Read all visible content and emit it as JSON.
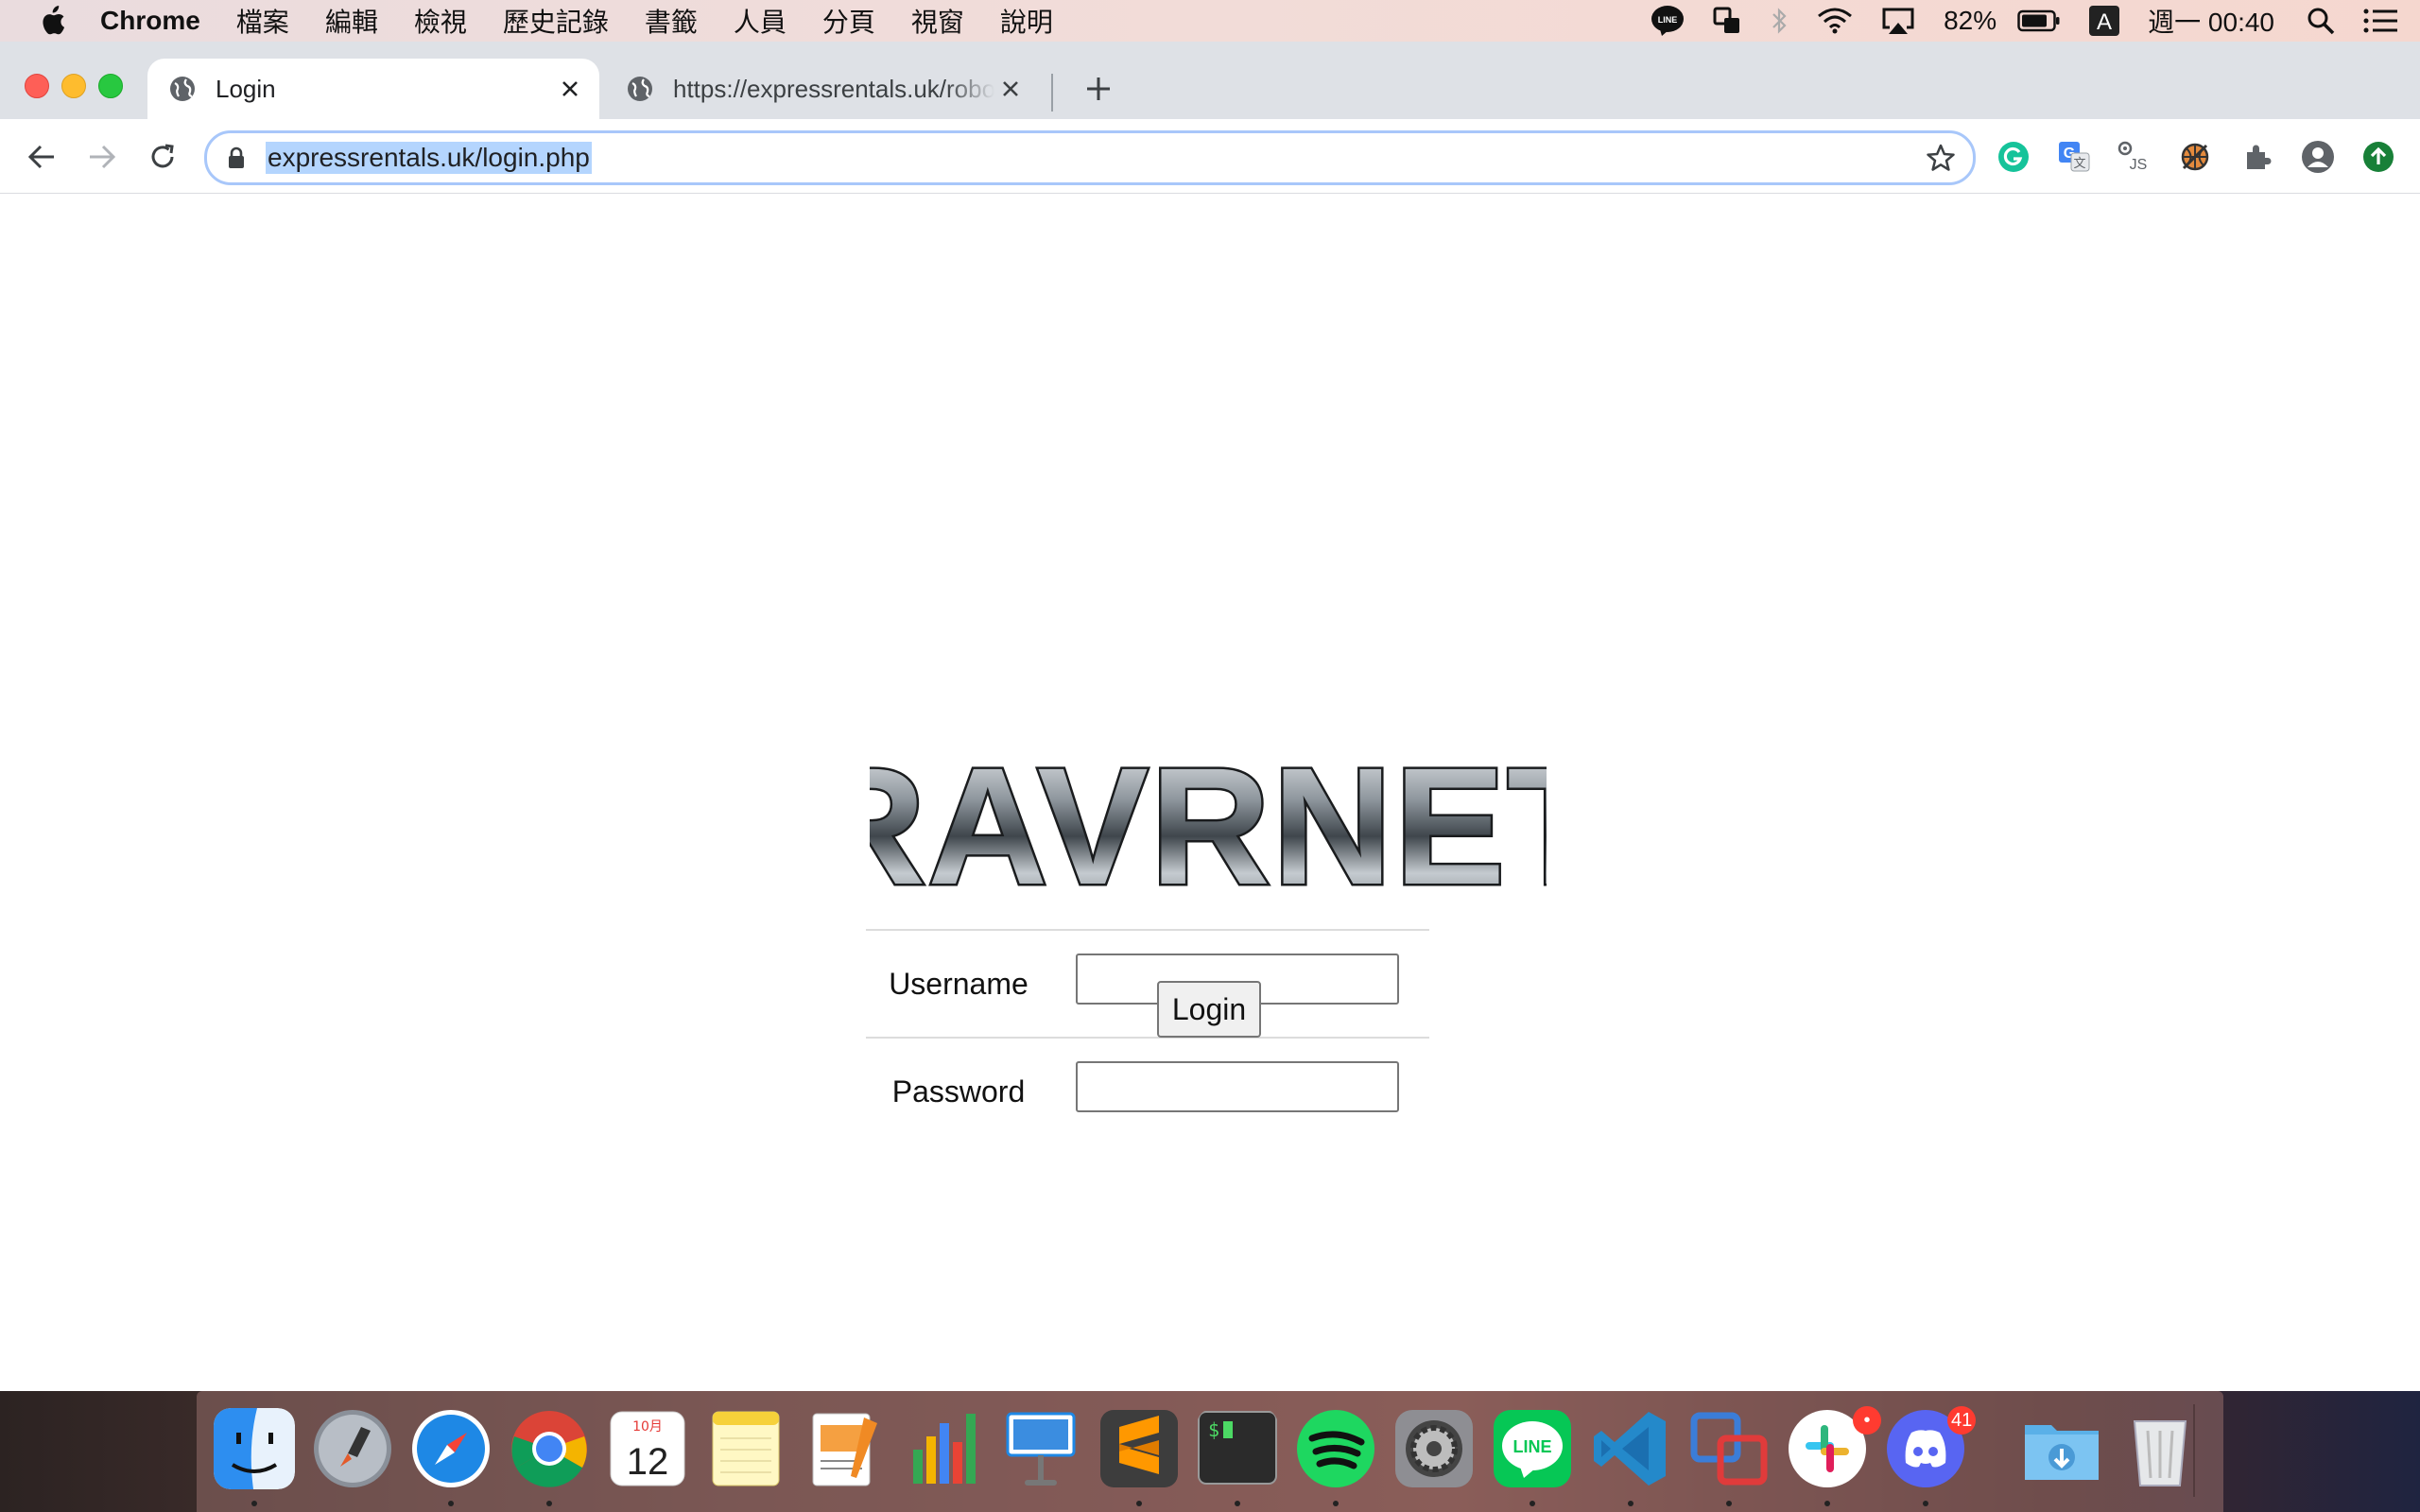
{
  "menubar": {
    "app_name": "Chrome",
    "menus": [
      "檔案",
      "編輯",
      "檢視",
      "歷史記錄",
      "書籤",
      "人員",
      "分頁",
      "視窗",
      "說明"
    ],
    "battery": "82%",
    "input_method": "A",
    "clock": "週一 00:40"
  },
  "browser": {
    "tabs": [
      {
        "title": "Login",
        "active": true
      },
      {
        "title": "https://expressrentals.uk/robots.txt",
        "active": false
      }
    ],
    "address": "expressrentals.uk/login.php"
  },
  "page": {
    "logo_text": "RAVRNET",
    "username_label": "Username",
    "username_value": "",
    "password_label": "Password",
    "password_value": "",
    "login_button": "Login"
  },
  "dock": {
    "calendar_month": "10月",
    "calendar_day": "12",
    "terminal_prompt": "$",
    "slack_badge": "•",
    "discord_badge": "41",
    "line_label": "LINE"
  },
  "colors": {
    "accent_highlight": "#b4d5fe",
    "omnibox_focus": "#a8c7fa",
    "tabstrip": "#dee1e6",
    "grammarly": "#15c39a",
    "update": "#188038"
  }
}
